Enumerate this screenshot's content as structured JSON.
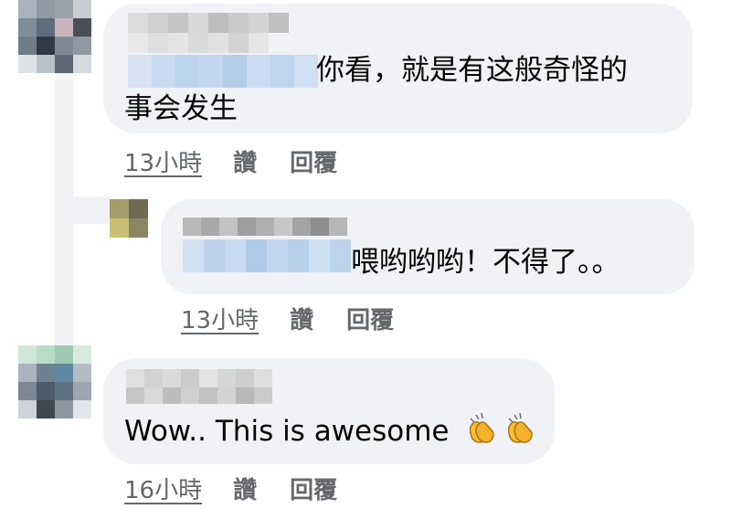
{
  "comments": [
    {
      "text_line1": "你看，就是有这般奇怪的",
      "text_line2": "事会发生",
      "time": "13小時",
      "like_label": "讚",
      "reply_label": "回覆"
    },
    {
      "text": "喂哟哟哟！不得了。。",
      "time": "13小時",
      "like_label": "讚",
      "reply_label": "回覆"
    },
    {
      "text": "Wow.. This is awesome",
      "emoji": [
        "clapping-hands-icon",
        "clapping-hands-icon"
      ],
      "time": "16小時",
      "like_label": "讚",
      "reply_label": "回覆"
    }
  ],
  "colors": {
    "bubble": "#f0f2f5",
    "meta_text": "#65676b",
    "text": "#050505"
  }
}
